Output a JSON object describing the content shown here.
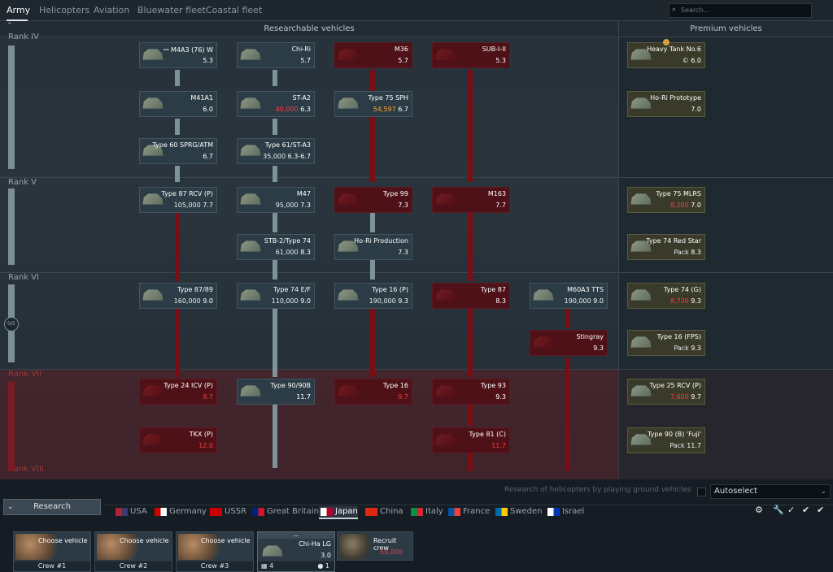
{
  "top_tabs": [
    "Army",
    "Helicopters",
    "Aviation",
    "Bluewater fleet",
    "Coastal fleet"
  ],
  "search_placeholder": "Search...",
  "headers": {
    "researchable": "Researchable vehicles",
    "premium": "Premium vehicles"
  },
  "ranks": [
    "Rank IV",
    "Rank V",
    "Rank VI",
    "Rank VII",
    "Rank VIII"
  ],
  "rank_progress": "0/5",
  "cards": [
    {
      "name": "ꟷ M4A3 (76) W",
      "val": "5.3",
      "col": "green"
    },
    {
      "name": "Chi-Ri",
      "val": "5.7",
      "col": "green"
    },
    {
      "name": "M36",
      "val": "5.7",
      "col": "red"
    },
    {
      "name": "SUB-I-II",
      "val": "5.3",
      "col": "red"
    },
    {
      "name": "M41A1",
      "val": "6.0",
      "col": "green"
    },
    {
      "name": "ST-A2",
      "cost": "40,000",
      "val": "6.3",
      "col": "green"
    },
    {
      "name": "Type 75 SPH",
      "cost": "54,597",
      "val": "6.7",
      "col": "green"
    },
    {
      "name": "Type 60 SPRG/ATM",
      "val": "6.7",
      "col": "green"
    },
    {
      "name": "Type 61/ST-A3",
      "cost": "35,000",
      "val": "6.3-6.7",
      "col": "green"
    },
    {
      "name": "Type 87 RCV (P)",
      "cost": "105,000",
      "val": "7.7",
      "col": "green"
    },
    {
      "name": "M47",
      "cost": "95,000",
      "val": "7.3",
      "col": "green"
    },
    {
      "name": "Type 99",
      "val": "7.3",
      "col": "red"
    },
    {
      "name": "M163",
      "val": "7.7",
      "col": "red"
    },
    {
      "name": "STB-2/Type 74",
      "cost": "61,000",
      "val": "8.3",
      "col": "green"
    },
    {
      "name": "Ho-Ri Production",
      "val": "7.3",
      "col": "green"
    },
    {
      "name": "Type 87/89",
      "cost": "160,000",
      "val": "9.0",
      "col": "green"
    },
    {
      "name": "Type 74 E/F",
      "cost": "110,000",
      "val": "9.0",
      "col": "green"
    },
    {
      "name": "Type 16 (P)",
      "cost": "190,000",
      "val": "9.3",
      "col": "green"
    },
    {
      "name": "Type 87",
      "val": "8.3",
      "col": "red"
    },
    {
      "name": "M60A3 TTS",
      "cost": "190,000",
      "val": "9.0",
      "col": "green"
    },
    {
      "name": "Stingray",
      "val": "9.3",
      "col": "red"
    },
    {
      "name": "Type 24 ICV (P)",
      "val": "9.7",
      "col": "red"
    },
    {
      "name": "Type 90/90B",
      "val": "11.7",
      "col": "green"
    },
    {
      "name": "Type 16",
      "val": "9.7",
      "col": "red"
    },
    {
      "name": "Type 93",
      "val": "9.3",
      "col": "red"
    },
    {
      "name": "TKX (P)",
      "val": "12.0",
      "col": "red"
    },
    {
      "name": "Type 81 (C)",
      "val": "11.7",
      "col": "red"
    }
  ],
  "premium": [
    {
      "name": "Heavy Tank No.6",
      "cost": "6.0",
      "val": "6.0",
      "extra": "©"
    },
    {
      "name": "Ho-Ri Prototype",
      "val": "7.0"
    },
    {
      "name": "Type 75 MLRS",
      "cost": "8,200",
      "val": "7.0"
    },
    {
      "name": "Type 74 Red Star",
      "pack": "Pack",
      "val": "8.3"
    },
    {
      "name": "Type 74 (G)",
      "cost": "8,730",
      "val": "9.3"
    },
    {
      "name": "Type 16 (FPS)",
      "pack": "Pack",
      "val": "9.3"
    },
    {
      "name": "Type 25 RCV (P)",
      "cost": "7,600",
      "val": "9.7"
    },
    {
      "name": "Type 90 (B) 'Fuji'",
      "pack": "Pack",
      "val": "11.7"
    }
  ],
  "hint": "Research of helicopters by playing ground vehicles",
  "autoselect": "Autoselect",
  "research_btn": "Research",
  "nations": [
    "USA",
    "Germany",
    "USSR",
    "Great Britain",
    "Japan",
    "China",
    "Italy",
    "France",
    "Sweden",
    "Israel"
  ],
  "crew": [
    {
      "label": "Choose vehicle",
      "num": "Crew #1"
    },
    {
      "label": "Choose vehicle",
      "num": "Crew #2"
    },
    {
      "label": "Choose vehicle",
      "num": "Crew #3"
    }
  ],
  "slot": {
    "name": "Chi-Ha LG",
    "br": "3.0",
    "crew_n": "4",
    "bottom": "1"
  },
  "recruit": {
    "label": "Recruit crew",
    "cost": "50,000"
  }
}
